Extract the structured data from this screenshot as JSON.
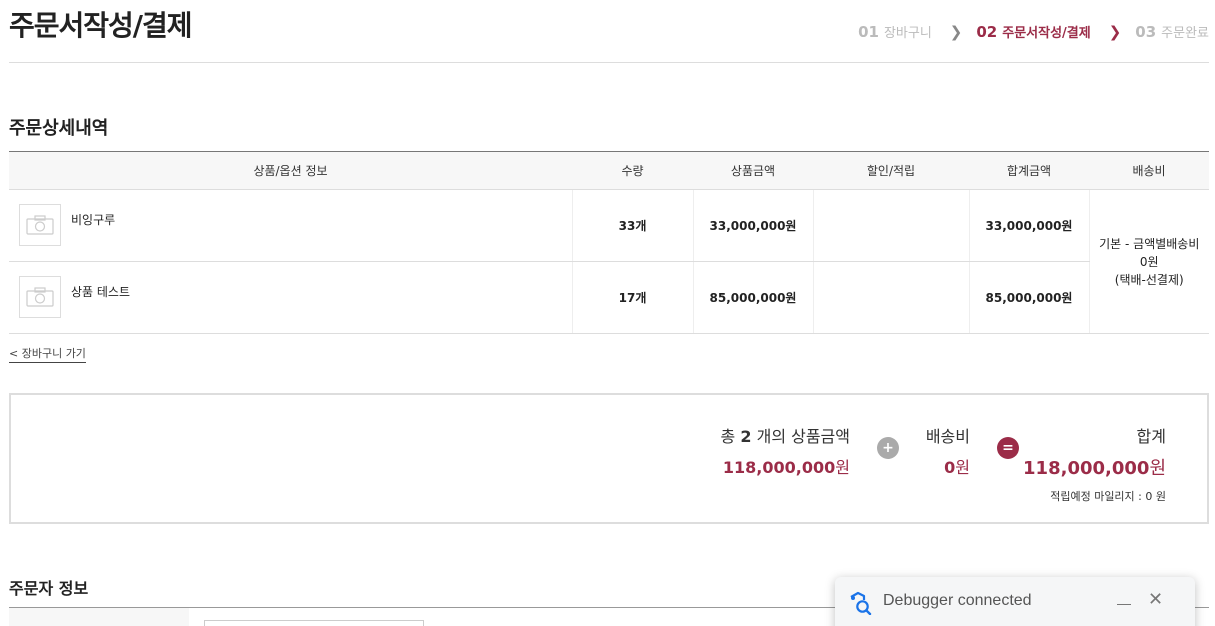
{
  "header": {
    "title": "주문서작성/결제",
    "steps": [
      {
        "num": "01",
        "label": "장바구니"
      },
      {
        "num": "02",
        "label": "주문서작성/결제"
      },
      {
        "num": "03",
        "label": "주문완료"
      }
    ]
  },
  "order_details": {
    "title": "주문상세내역",
    "columns": [
      "상품/옵션 정보",
      "수량",
      "상품금액",
      "할인/적립",
      "합계금액",
      "배송비"
    ],
    "rows": [
      {
        "name": "비잉구루",
        "qty": "33개",
        "price": "33,000,000원",
        "discount": "",
        "total": "33,000,000원"
      },
      {
        "name": "상품 테스트",
        "qty": "17개",
        "price": "85,000,000원",
        "discount": "",
        "total": "85,000,000원"
      }
    ],
    "shipping": {
      "line1": "기본 - 금액별배송비",
      "line2": "0원",
      "line3": "(택배-선결제)"
    }
  },
  "back_link": "< 장바구니 가기",
  "summary": {
    "items_prefix": "총",
    "items_count": "2",
    "items_suffix": "개의 상품금액",
    "items_amount": "118,000,000",
    "shipping_label": "배송비",
    "shipping_amount": "0",
    "total_label": "합계",
    "total_amount": "118,000,000",
    "unit": "원",
    "plus_symbol": "+",
    "equals_symbol": "=",
    "mileage": "적립예정 마일리지 : 0 원"
  },
  "orderer": {
    "title": "주문자 정보"
  },
  "toast": {
    "text": "Debugger connected"
  },
  "colors": {
    "accent": "#9b2c48",
    "muted": "#bbbbbb"
  }
}
